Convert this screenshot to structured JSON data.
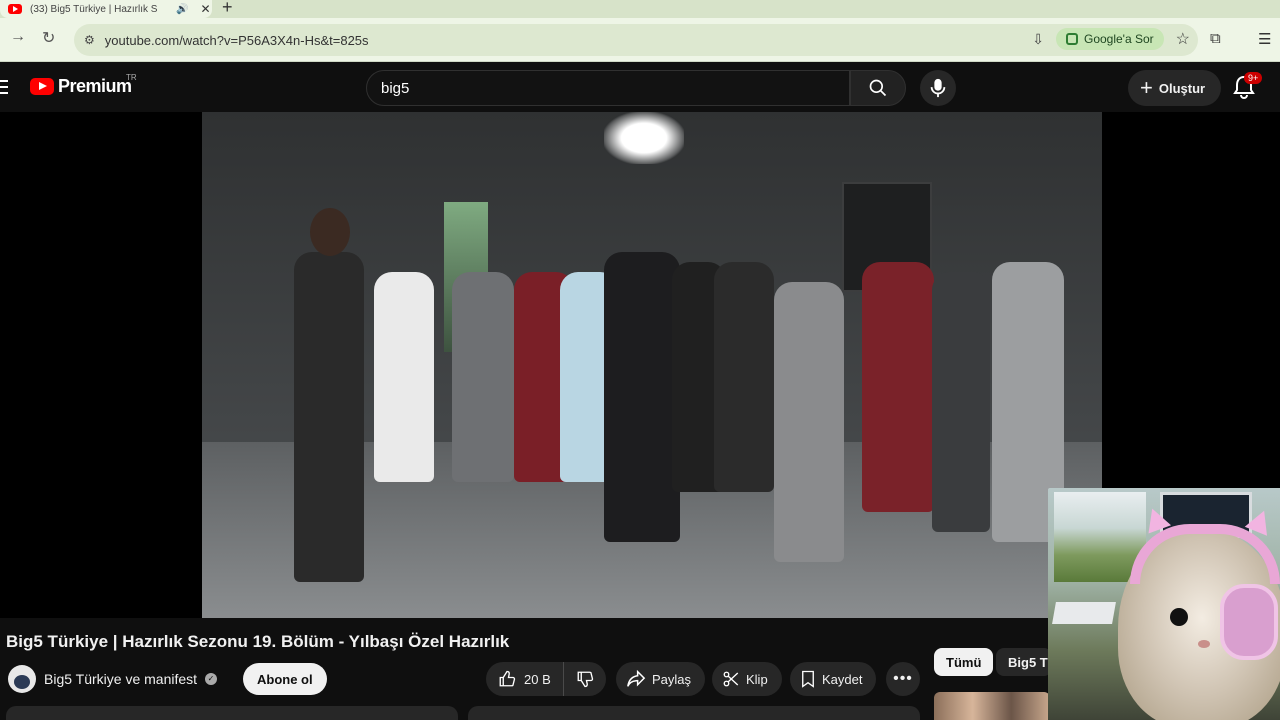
{
  "browser": {
    "tab_title": "(33) Big5 Türkiye | Hazırlık S",
    "url": "youtube.com/watch?v=P56A3X4n-Hs&t=825s",
    "ask_google_label": "Google'a Sor",
    "new_tab_label": "+",
    "tab_close_label": "✕"
  },
  "header": {
    "logo_text": "Premium",
    "region": "TR",
    "search_value": "big5",
    "create_label": "Oluştur",
    "notification_count": "9+"
  },
  "video": {
    "title": "Big5 Türkiye | Hazırlık Sezonu 19. Bölüm - Yılbaşı Özel Hazırlık",
    "channel_name": "Big5 Türkiye ve manifest",
    "subscribe_label": "Abone ol",
    "likes": "20 B",
    "share_label": "Paylaş",
    "clip_label": "Klip",
    "save_label": "Kaydet",
    "more_label": "•••"
  },
  "chips": {
    "all": "Tümü",
    "big5": "Big5 Türkiye"
  },
  "colors": {
    "accent": "#ff0000",
    "background": "#0f0f0f",
    "surface": "#272727",
    "browser_chrome": "#eef5e6"
  },
  "icons": [
    "youtube-play-icon",
    "hamburger-icon",
    "search-icon",
    "mic-icon",
    "plus-icon",
    "bell-icon",
    "thumbs-up-icon",
    "thumbs-down-icon",
    "share-icon",
    "scissors-icon",
    "bookmark-icon",
    "more-icon",
    "verified-icon",
    "reload-icon",
    "forward-icon",
    "star-icon",
    "extensions-icon",
    "tab-search-icon"
  ]
}
